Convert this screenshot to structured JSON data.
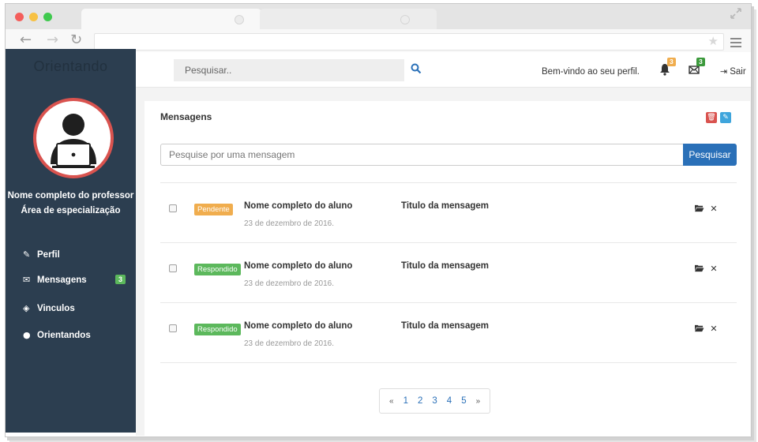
{
  "sidebar": {
    "brand": "Orientando",
    "professor_name": "Nome completo do professor",
    "specialization": "Área de especialização",
    "items": [
      {
        "label": "Perfil",
        "icon": "pencil-icon"
      },
      {
        "label": "Mensagens",
        "icon": "envelope-icon",
        "badge": "3"
      },
      {
        "label": "Vinculos",
        "icon": "tags-icon"
      },
      {
        "label": "Orientandos",
        "icon": "user-icon"
      }
    ]
  },
  "topbar": {
    "search_placeholder": "Pesquisar..",
    "welcome": "Bem-vindo ao seu perfil.",
    "notifications_badge": "3",
    "messages_badge": "3",
    "logout": "Sair"
  },
  "panel": {
    "title": "Mensagens",
    "search_placeholder": "Pesquise por uma mensagem",
    "search_button": "Pesquisar"
  },
  "messages": [
    {
      "status": "Pendente",
      "student": "Nome completo do aluno",
      "date": "23 de dezembro de 2016.",
      "subject": "Titulo da mensagem"
    },
    {
      "status": "Respondido",
      "student": "Nome completo do aluno",
      "date": "23 de dezembro de 2016.",
      "subject": "Titulo da mensagem"
    },
    {
      "status": "Respondido",
      "student": "Nome completo do aluno",
      "date": "23 de dezembro de 2016.",
      "subject": "Titulo da mensagem"
    }
  ],
  "pagination": {
    "prev": "«",
    "pages": [
      "1",
      "2",
      "3",
      "4",
      "5"
    ],
    "next": "»"
  },
  "colors": {
    "sidebar": "#2c3e50",
    "pending": "#f0ad4e",
    "answered": "#5cb85c",
    "primary": "#2a70b8",
    "danger": "#d9534f"
  }
}
